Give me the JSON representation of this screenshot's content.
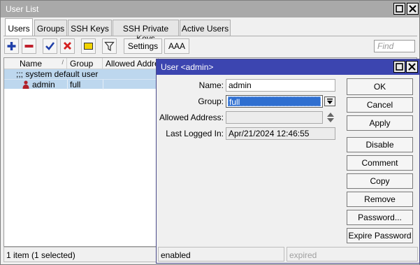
{
  "main_window": {
    "title": "User List",
    "tabs": [
      {
        "label": "Users",
        "active": true
      },
      {
        "label": "Groups",
        "active": false
      },
      {
        "label": "SSH Keys",
        "active": false
      },
      {
        "label": "SSH Private Keys",
        "active": false
      },
      {
        "label": "Active Users",
        "active": false
      }
    ],
    "toolbar": {
      "buttons": [
        "add-icon",
        "remove-icon",
        "enable-check-icon",
        "disable-x-icon",
        "comment-note-icon",
        "filter-icon"
      ],
      "settings_label": "Settings",
      "aaa_label": "AAA",
      "find_placeholder": "Find"
    },
    "table": {
      "columns": [
        "Name",
        "Group",
        "Allowed Address"
      ],
      "sort_indicator": "/",
      "rows": [
        {
          "type": "comment",
          "text": ";;; system default user"
        },
        {
          "type": "user",
          "name": "admin",
          "group": "full",
          "allowed_address": "",
          "icon": "user-icon"
        }
      ]
    },
    "status": "1 item (1 selected)"
  },
  "dialog": {
    "title": "User <admin>",
    "fields": {
      "name_label": "Name:",
      "name_value": "admin",
      "group_label": "Group:",
      "group_value": "full",
      "allowed_address_label": "Allowed Address:",
      "allowed_address_value": "",
      "last_logged_in_label": "Last Logged In:",
      "last_logged_in_value": "Apr/21/2024 12:46:55"
    },
    "buttons": {
      "ok": "OK",
      "cancel": "Cancel",
      "apply": "Apply",
      "disable": "Disable",
      "comment": "Comment",
      "copy": "Copy",
      "remove": "Remove",
      "password": "Password...",
      "expire_password": "Expire Password"
    },
    "status_left": "enabled",
    "status_right": "expired"
  },
  "colors": {
    "main_title_bg": "#a9a9a9",
    "dialog_title_bg": "#3c45b0",
    "selected_row": "#bdd7ee",
    "add_icon": "#1f3fa8",
    "remove_icon": "#c0202c",
    "check_icon": "#1f3fa8",
    "x_icon": "#d42020",
    "note_icon": "#f2d300"
  }
}
